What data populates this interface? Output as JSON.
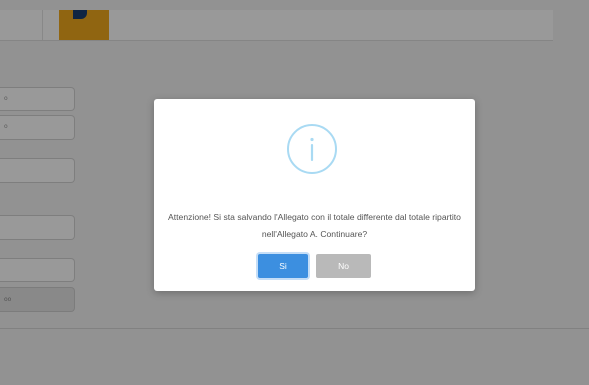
{
  "background": {
    "fields": [
      {
        "text": "o"
      },
      {
        "text": "o"
      },
      {
        "text": ""
      },
      {
        "text": ""
      },
      {
        "text": ""
      }
    ],
    "field_button": {
      "text": "oo"
    }
  },
  "dialog": {
    "icon": "info-icon",
    "message": "Attenzione! Si sta salvando l'Allegato con il totale differente dal totale ripartito nell'Allegato A. Continuare?",
    "confirm_label": "Si",
    "cancel_label": "No",
    "colors": {
      "confirm": "#3c8fe0",
      "cancel": "#b9b9b9",
      "icon": "#a9daf3"
    }
  }
}
